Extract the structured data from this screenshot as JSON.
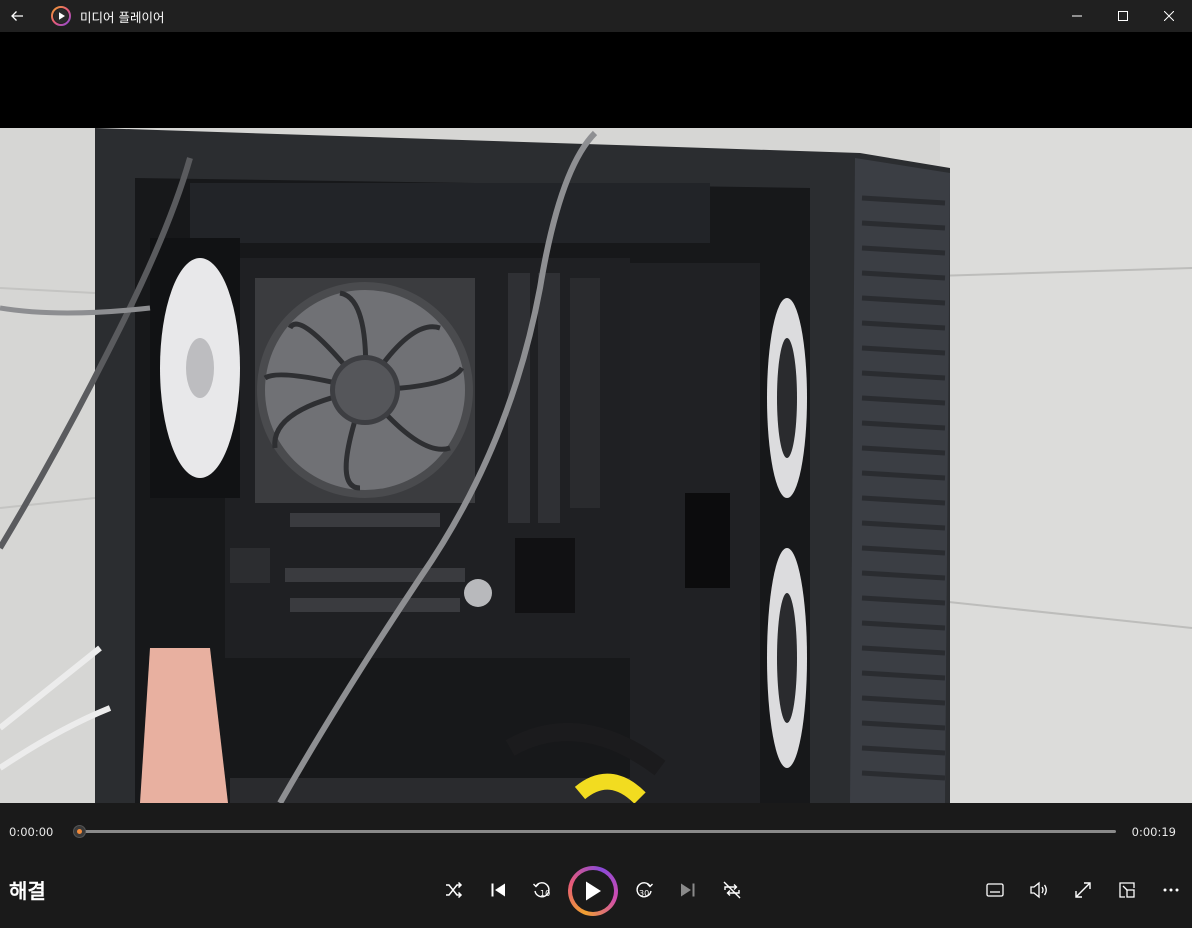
{
  "window": {
    "title": "미디어 플레이어"
  },
  "player": {
    "time_current": "0:00:00",
    "time_total": "0:00:19",
    "progress": 0,
    "media_title": "해결"
  },
  "colors": {
    "accent": "#f28a3a",
    "background": "#1a1a1a"
  },
  "icons": {
    "back": "arrow-left-icon",
    "minimize": "minimize-icon",
    "maximize": "maximize-icon",
    "close": "close-icon",
    "shuffle": "shuffle-icon",
    "previous": "previous-icon",
    "rewind": "rewind-10-icon",
    "play": "play-icon",
    "forward": "forward-30-icon",
    "next": "next-icon",
    "repeat": "repeat-off-icon",
    "subtitles": "subtitles-icon",
    "volume": "volume-icon",
    "fullscreen": "fullscreen-icon",
    "miniplayer": "miniplayer-icon",
    "more": "more-icon"
  }
}
